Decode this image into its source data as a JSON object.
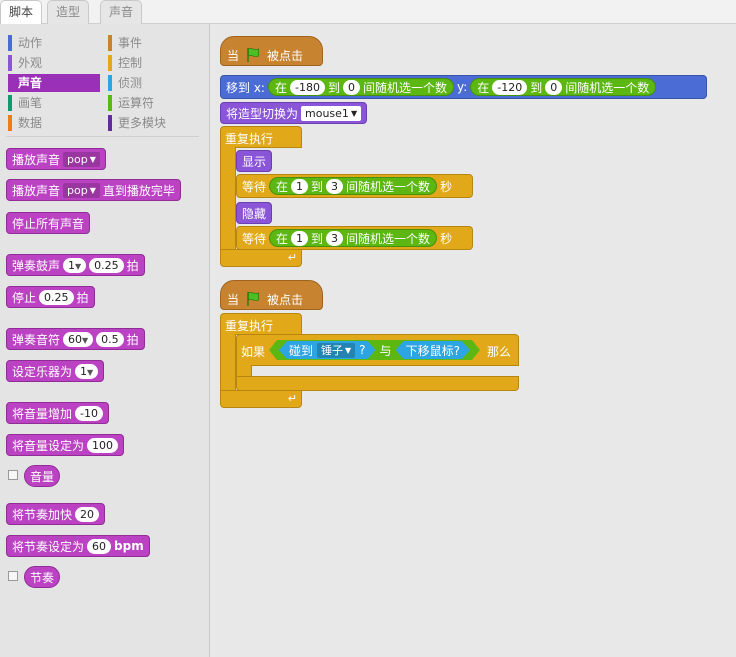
{
  "tabs": [
    "脚本",
    "造型",
    "声音"
  ],
  "categories": [
    {
      "label": "动作",
      "color": "#4a6cd4"
    },
    {
      "label": "事件",
      "color": "#c88330"
    },
    {
      "label": "外观",
      "color": "#8a55d7"
    },
    {
      "label": "控制",
      "color": "#e1a91a"
    },
    {
      "label": "声音",
      "color": "#bb42c3"
    },
    {
      "label": "侦测",
      "color": "#2ca5e2"
    },
    {
      "label": "画笔",
      "color": "#0e9a6c"
    },
    {
      "label": "运算符",
      "color": "#5cb712"
    },
    {
      "label": "数据",
      "color": "#ee7d16"
    },
    {
      "label": "更多模块",
      "color": "#632d99"
    }
  ],
  "palette": {
    "play_sound": "播放声音",
    "play_sound_until_done_suffix": "直到播放完毕",
    "sound_name": "pop",
    "stop_all_sounds": "停止所有声音",
    "play_drum": "弹奏鼓声",
    "drum_value": "1",
    "beats_value": "0.25",
    "beats": "拍",
    "rest": "停止",
    "rest_value": "0.25",
    "play_note": "弹奏音符",
    "note_value": "60",
    "note_beats": "0.5",
    "set_instrument": "设定乐器为",
    "instrument_value": "1",
    "change_volume": "将音量增加",
    "change_volume_value": "-10",
    "set_volume": "将音量设定为",
    "set_volume_value": "100",
    "volume_reporter": "音量",
    "change_tempo": "将节奏加快",
    "change_tempo_value": "20",
    "set_tempo": "将节奏设定为",
    "set_tempo_value": "60",
    "bpm": "bpm",
    "tempo_reporter": "节奏"
  },
  "script1": {
    "when": "当",
    "clicked": "被点击",
    "goto": "移到 x:",
    "at": "在",
    "to": "到",
    "random": "间随机选一个数",
    "y": "y:",
    "x_from": "-180",
    "x_to": "0",
    "y_from": "-120",
    "y_to": "0",
    "switch_costume": "将造型切换为",
    "costume": "mouse1",
    "forever": "重复执行",
    "show": "显示",
    "wait": "等待",
    "wait_from": "1",
    "wait_to": "3",
    "seconds": "秒",
    "hide": "隐藏"
  },
  "script2": {
    "when": "当",
    "clicked": "被点击",
    "forever": "重复执行",
    "if": "如果",
    "touching": "碰到",
    "touching_target": "锤子",
    "question": "?",
    "and": "与",
    "mouse_down": "下移鼠标?",
    "then": "那么"
  }
}
